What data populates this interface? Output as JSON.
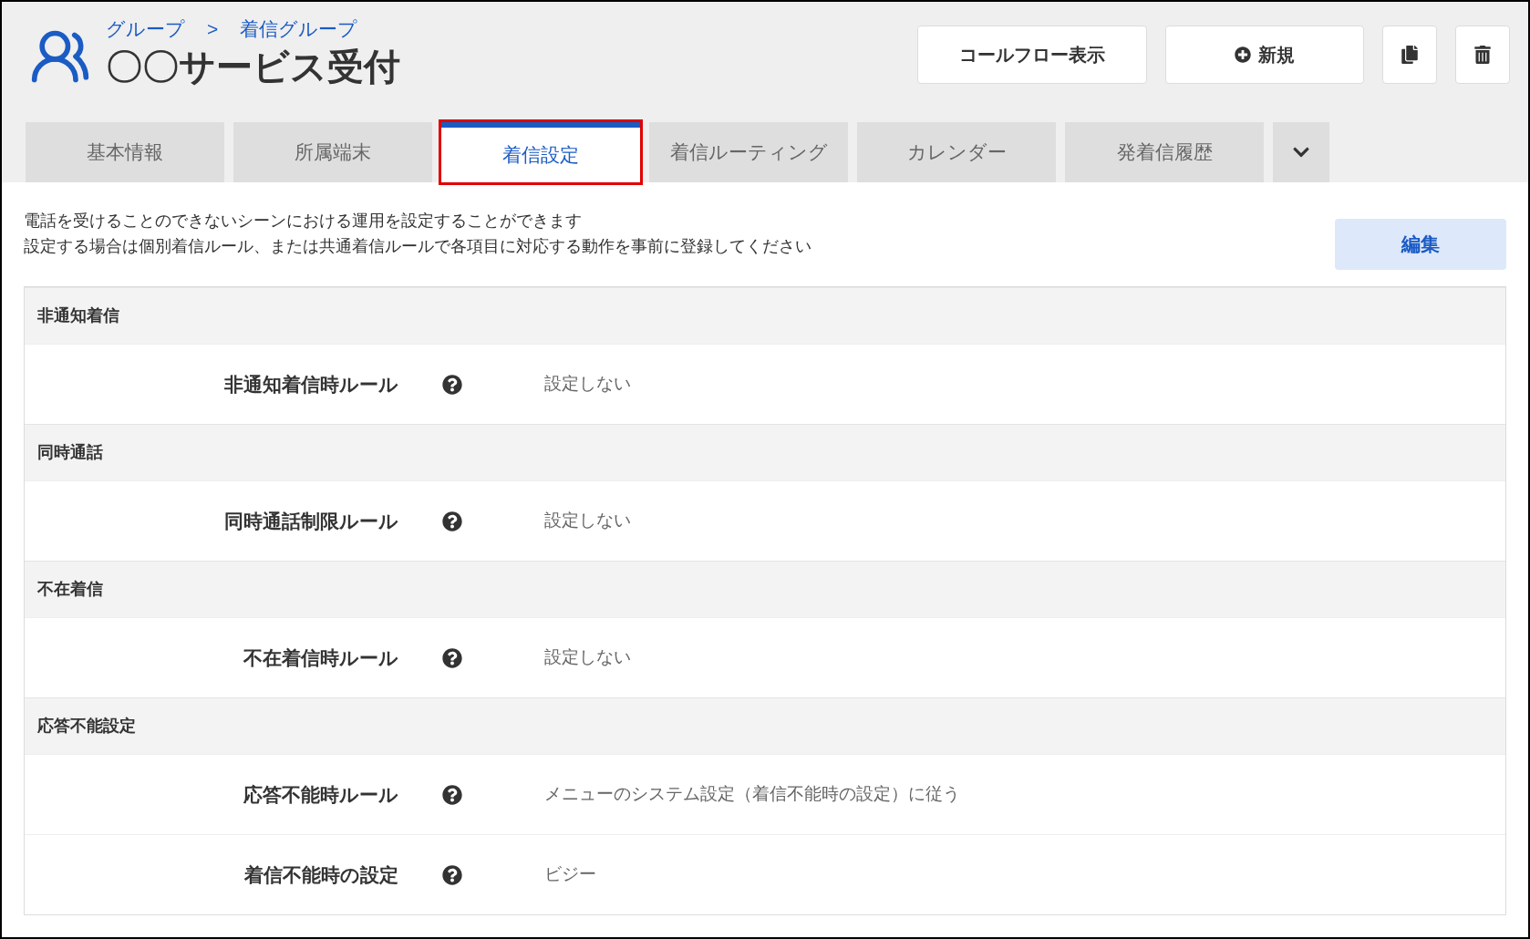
{
  "breadcrumb": {
    "items": [
      "グループ",
      "着信グループ"
    ],
    "separator": ">"
  },
  "title": "〇〇サービス受付",
  "header_buttons": [
    {
      "kind": "text",
      "label": "コールフロー表示"
    },
    {
      "kind": "add",
      "label": "新規"
    },
    {
      "kind": "copy"
    },
    {
      "kind": "delete"
    }
  ],
  "tabs": [
    {
      "label": "基本情報",
      "selected": false,
      "highlighted": false
    },
    {
      "label": "所属端末",
      "selected": false,
      "highlighted": false
    },
    {
      "label": "着信設定",
      "selected": true,
      "highlighted": true
    },
    {
      "label": "着信ルーティング",
      "selected": false,
      "highlighted": false
    },
    {
      "label": "カレンダー",
      "selected": false,
      "highlighted": false
    },
    {
      "label": "発着信履歴",
      "selected": false,
      "highlighted": false
    }
  ],
  "description": [
    "電話を受けることのできないシーンにおける運用を設定することができます",
    "設定する場合は個別着信ルール、または共通着信ルールで各項目に対応する動作を事前に登録してください"
  ],
  "edit_button": "編集",
  "sections": [
    {
      "title": "非通知着信",
      "rows": [
        {
          "label": "非通知着信時ルール",
          "value": "設定しない"
        }
      ]
    },
    {
      "title": "同時通話",
      "rows": [
        {
          "label": "同時通話制限ルール",
          "value": "設定しない"
        }
      ]
    },
    {
      "title": "不在着信",
      "rows": [
        {
          "label": "不在着信時ルール",
          "value": "設定しない"
        }
      ]
    },
    {
      "title": "応答不能設定",
      "rows": [
        {
          "label": "応答不能時ルール",
          "value": "メニューのシステム設定（着信不能時の設定）に従う"
        },
        {
          "label": "着信不能時の設定",
          "value": "ビジー"
        }
      ]
    }
  ]
}
